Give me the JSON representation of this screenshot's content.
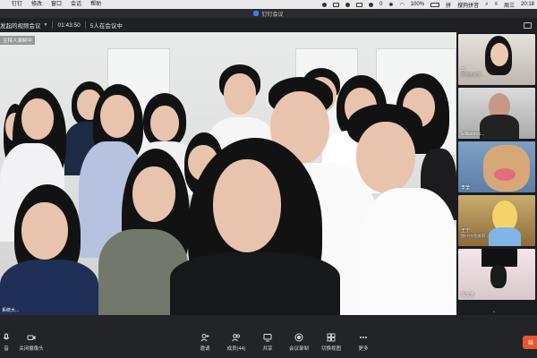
{
  "menubar": {
    "app_name": "钉钉",
    "menus": [
      "修改",
      "窗口",
      "会话",
      "帮助"
    ],
    "status_zero": "0",
    "battery": "100%",
    "app_right": "搜狗拼音",
    "day": "周三",
    "time": "20:18"
  },
  "window": {
    "title": "钉钉会议"
  },
  "meeting": {
    "name": "发起的视频会议",
    "duration": "01:43:50",
    "participants_text": "5人在会议中"
  },
  "main_video": {
    "recording_label": "主持人录制中",
    "bottom_text": "系统大..."
  },
  "gallery": {
    "tiles": [
      {
        "name": "云",
        "sub": "影视会议系..."
      },
      {
        "name": "williamroc...",
        "sub": ""
      },
      {
        "name": "李莹",
        "sub": ""
      },
      {
        "name": "王宁",
        "sub": "摄HTR会展影..."
      },
      {
        "name": "陈文杰",
        "sub": ""
      }
    ]
  },
  "toolbar": {
    "mute_label": "音",
    "camera_label": "关闭摄像头",
    "invite_label": "邀请",
    "members_label": "成员(44)",
    "share_label": "共享",
    "record_label": "会议录制",
    "layout_label": "切换视图",
    "more_label": "更多",
    "end_label": "结"
  },
  "colors": {
    "accent": "#3a7bf6",
    "end_button": "#e8552f"
  }
}
